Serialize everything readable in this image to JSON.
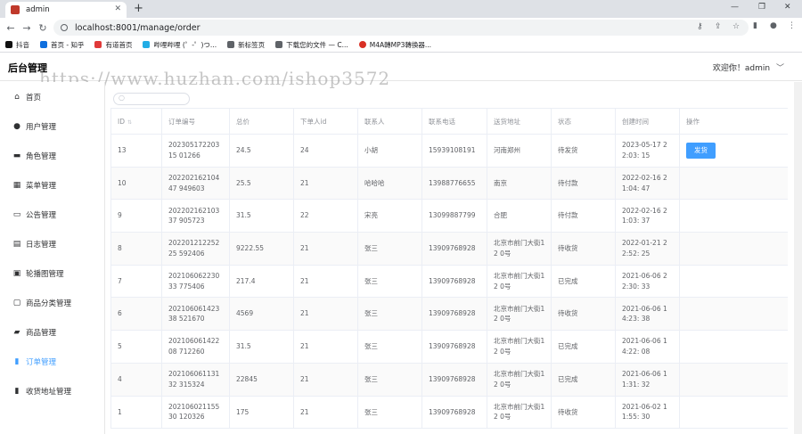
{
  "browser": {
    "tab_title": "admin",
    "new_tab": "+",
    "url": "localhost:8001/manage/order",
    "bookmarks": [
      {
        "label": "抖音",
        "color": "#111111"
      },
      {
        "label": "首页 - 知乎",
        "color": "#0f6fde"
      },
      {
        "label": "有道首页",
        "color": "#e03a3a"
      },
      {
        "label": "哔哩哔哩 (゜-゜)つ...",
        "color": "#23ade5"
      },
      {
        "label": "新标签页",
        "color": "#5f6368"
      },
      {
        "label": "下载您的文件 — C...",
        "color": "#5f6368"
      },
      {
        "label": "M4A轉MP3轉換器...",
        "color": "#d93025"
      }
    ]
  },
  "header": {
    "logo": "后台管理",
    "welcome": "欢迎你！admin"
  },
  "watermark": "https://www.huzhan.com/ishop3572",
  "sidebar": {
    "items": [
      {
        "label": "首页",
        "icon": "home-icon"
      },
      {
        "label": "用户管理",
        "icon": "user-icon"
      },
      {
        "label": "角色管理",
        "icon": "role-icon"
      },
      {
        "label": "菜单管理",
        "icon": "menu-icon"
      },
      {
        "label": "公告管理",
        "icon": "notice-icon"
      },
      {
        "label": "日志管理",
        "icon": "log-icon"
      },
      {
        "label": "轮播图管理",
        "icon": "image-icon"
      },
      {
        "label": "商品分类管理",
        "icon": "category-icon"
      },
      {
        "label": "商品管理",
        "icon": "goods-icon"
      },
      {
        "label": "订单管理",
        "icon": "chart-icon"
      },
      {
        "label": "收货地址管理",
        "icon": "chart-icon"
      }
    ],
    "active_index": 9
  },
  "table": {
    "columns": [
      "ID",
      "订单编号",
      "总价",
      "下单人id",
      "联系人",
      "联系电话",
      "送货地址",
      "状态",
      "创建时间",
      "操作"
    ],
    "ship_button": "发货",
    "rows": [
      {
        "id": "13",
        "order_no": "20230517220315 01266",
        "total": "24.5",
        "user_id": "24",
        "contact": "小胡",
        "phone": "15939108191",
        "address": "河南郑州",
        "status": "待发货",
        "created": "2023-05-17 22:03: 15",
        "action": true
      },
      {
        "id": "10",
        "order_no": "20220216210447 949603",
        "total": "25.5",
        "user_id": "21",
        "contact": "哈哈哈",
        "phone": "13988776655",
        "address": "南京",
        "status": "待付款",
        "created": "2022-02-16 21:04: 47",
        "action": false
      },
      {
        "id": "9",
        "order_no": "20220216210337 905723",
        "total": "31.5",
        "user_id": "22",
        "contact": "宋亮",
        "phone": "13099887799",
        "address": "合肥",
        "status": "待付款",
        "created": "2022-02-16 21:03: 37",
        "action": false
      },
      {
        "id": "8",
        "order_no": "20220121225225 592406",
        "total": "9222.55",
        "user_id": "21",
        "contact": "张三",
        "phone": "13909768928",
        "address": "北京市前门大街12 0号",
        "status": "待收货",
        "created": "2022-01-21 22:52: 25",
        "action": false
      },
      {
        "id": "7",
        "order_no": "20210606223033 775406",
        "total": "217.4",
        "user_id": "21",
        "contact": "张三",
        "phone": "13909768928",
        "address": "北京市前门大街12 0号",
        "status": "已完成",
        "created": "2021-06-06 22:30: 33",
        "action": false
      },
      {
        "id": "6",
        "order_no": "20210606142338 521670",
        "total": "4569",
        "user_id": "21",
        "contact": "张三",
        "phone": "13909768928",
        "address": "北京市前门大街12 0号",
        "status": "待收货",
        "created": "2021-06-06 14:23: 38",
        "action": false
      },
      {
        "id": "5",
        "order_no": "20210606142208 712260",
        "total": "31.5",
        "user_id": "21",
        "contact": "张三",
        "phone": "13909768928",
        "address": "北京市前门大街12 0号",
        "status": "已完成",
        "created": "2021-06-06 14:22: 08",
        "action": false
      },
      {
        "id": "4",
        "order_no": "20210606113132 315324",
        "total": "22845",
        "user_id": "21",
        "contact": "张三",
        "phone": "13909768928",
        "address": "北京市前门大街12 0号",
        "status": "已完成",
        "created": "2021-06-06 11:31: 32",
        "action": false
      },
      {
        "id": "1",
        "order_no": "20210602115530 120326",
        "total": "175",
        "user_id": "21",
        "contact": "张三",
        "phone": "13909768928",
        "address": "北京市前门大街12 0号",
        "status": "待收货",
        "created": "2021-06-02 11:55: 30",
        "action": false
      }
    ]
  }
}
